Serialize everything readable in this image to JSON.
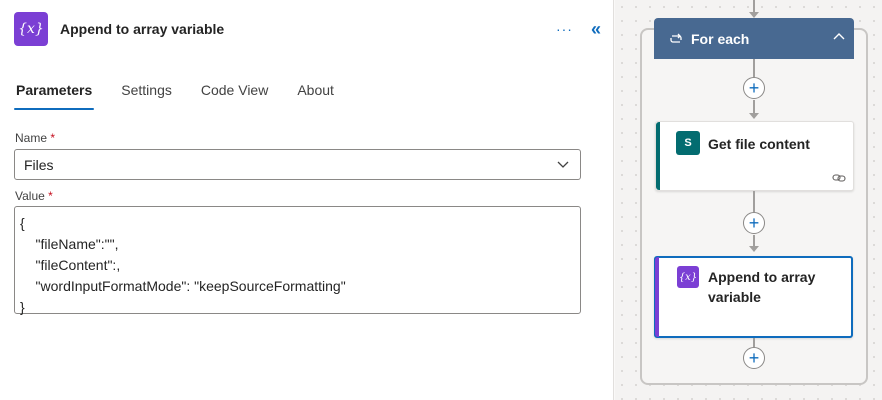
{
  "panel": {
    "title": "Append to array variable",
    "icon_glyph": "{x}",
    "more_label": "···",
    "collapse_label": "«"
  },
  "tabs": [
    {
      "label": "Parameters",
      "active": true
    },
    {
      "label": "Settings",
      "active": false
    },
    {
      "label": "Code View",
      "active": false
    },
    {
      "label": "About",
      "active": false
    }
  ],
  "fields": {
    "name_label": "Name",
    "name_value": "Files",
    "value_label": "Value",
    "required_mark": "*",
    "value_text": "{\n    \"fileName\":\"\",\n    \"fileContent\":,\n    \"wordInputFormatMode\": \"keepSourceFormatting\"\n}"
  },
  "canvas": {
    "foreach_label": "For each",
    "get_file_title": "Get file content",
    "sp_glyph": "S",
    "append_title_line1": "Append to array",
    "append_title_line2": "variable",
    "var_glyph": "{x}",
    "plus_glyph": "+"
  },
  "colors": {
    "accent": "#0f6cbd",
    "variable": "#7b3fd4",
    "foreach": "#486991",
    "sharepoint": "#036c70"
  }
}
